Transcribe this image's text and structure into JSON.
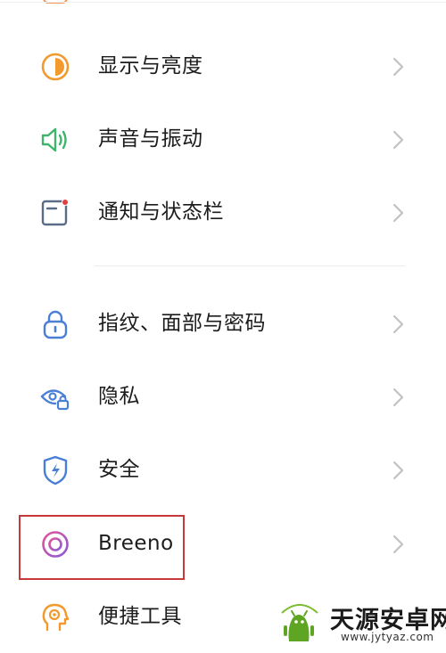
{
  "settings": {
    "items": [
      {
        "label": "显示与亮度",
        "icon": "display-brightness-icon",
        "color": "#f29a2e"
      },
      {
        "label": "声音与振动",
        "icon": "speaker-icon",
        "color": "#3fb46a"
      },
      {
        "label": "通知与状态栏",
        "icon": "notification-icon",
        "color": "#5a6b88"
      },
      {
        "label": "指纹、面部与密码",
        "icon": "lock-icon",
        "color": "#4a7fd6"
      },
      {
        "label": "隐私",
        "icon": "privacy-eye-icon",
        "color": "#4a7fd6"
      },
      {
        "label": "安全",
        "icon": "security-shield-icon",
        "color": "#4a7fd6"
      },
      {
        "label": "Breeno",
        "icon": "breeno-icon",
        "color": "#b558c8"
      },
      {
        "label": "便捷工具",
        "icon": "convenience-tools-icon",
        "color": "#f29a2e"
      }
    ]
  },
  "watermark": {
    "title": "天源安卓网",
    "url": "www.jytyaz.com"
  },
  "colors": {
    "highlight": "#c8383a",
    "chevron": "#c2c2c2"
  }
}
